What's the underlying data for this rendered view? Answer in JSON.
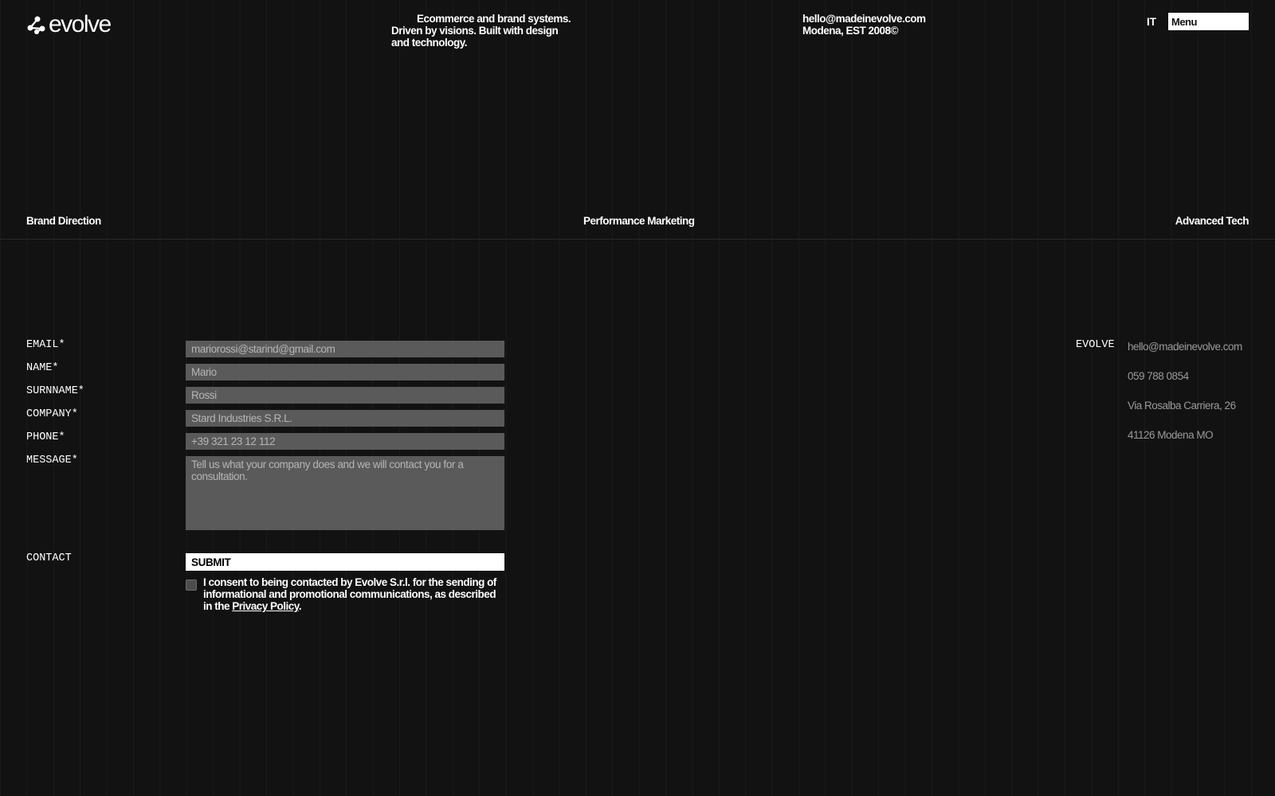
{
  "header": {
    "logo_text": "evolve",
    "tagline": "Ecommerce and brand systems. Driven by visions. Built with design and technology.",
    "email": "hello@madeinevolve.com",
    "location": "Modena, EST 2008©",
    "lang": "IT",
    "menu_label": "Menu"
  },
  "services": [
    "Brand Direction",
    "Performance Marketing",
    "Advanced Tech"
  ],
  "form": {
    "labels": {
      "email": "EMAIL*",
      "name": "NAME*",
      "surname": "SURNNAME*",
      "company": "COMPANY*",
      "phone": "PHONE*",
      "message": "MESSAGE*",
      "contact": "CONTACT"
    },
    "placeholders": {
      "email": "mariorossi@starind@gmail.com",
      "name": "Mario",
      "surname": "Rossi",
      "company": "Stard Industries S.R.L.",
      "phone": "+39 321 23 12 112",
      "message": "Tell us what your company does and we will contact you for a consultation."
    },
    "submit_label": "SUBMIT",
    "consent_text": "I consent to being contacted by Evolve S.r.l. for the sending of informational and promotional communications, as described in the ",
    "privacy_link": "Privacy Policy",
    "consent_end": "."
  },
  "side": {
    "brand": "EVOLVE",
    "email": "hello@madeinevolve.com",
    "phone": "059 788 0854",
    "address": "Via Rosalba Carriera, 26",
    "city": "41126 Modena MO"
  }
}
